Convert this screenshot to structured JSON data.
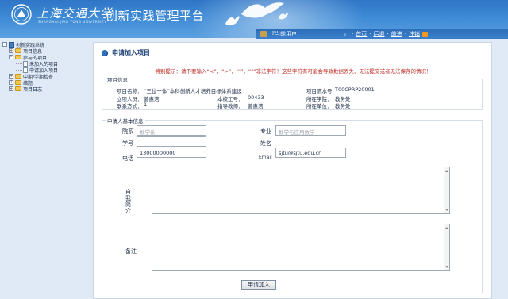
{
  "header": {
    "university_name": "上海交通大学",
    "university_name_en": "SHANGHAI JIAO TONG UNIVERSITY",
    "system_title": "创新实践管理平台",
    "current_user_label": "『当前用户：",
    "current_user_value": "",
    "current_user_close": "』",
    "links": [
      "首页",
      "后退",
      "前进",
      "注销"
    ],
    "brand_color": "#3e8ad6"
  },
  "sidebar": {
    "items": [
      {
        "label": "创新实践系统",
        "expander": "-",
        "icon": "system-icon",
        "level": 0
      },
      {
        "label": "项目信息",
        "expander": "+",
        "icon": "folder-icon",
        "level": 1
      },
      {
        "label": "参与的项目",
        "expander": "-",
        "icon": "folder-icon",
        "level": 1
      },
      {
        "label": "未加入的项目",
        "expander": "",
        "icon": "page-icon",
        "level": 2
      },
      {
        "label": "申请加入项目",
        "expander": "",
        "icon": "page-icon",
        "level": 2
      },
      {
        "label": "中期/学期检查",
        "expander": "+",
        "icon": "folder-icon",
        "level": 1
      },
      {
        "label": "结题",
        "expander": "+",
        "icon": "folder-icon",
        "level": 1
      },
      {
        "label": "项目日志",
        "expander": "+",
        "icon": "folder-icon",
        "level": 1
      }
    ]
  },
  "main": {
    "title": "申请加入项目",
    "warning": "特别提示：请不要输入“<”，“>”，“'”，“\"”非法字符！这些字符有可能会导致数据丢失、无法提交或者无法保存的情况！",
    "project_info": {
      "legend": "项目信息",
      "project_name_label": "项目名称：",
      "project_name": "“三位一体”本科创新人才培养目标体系建设",
      "serial_label": "项目流水号",
      "serial": "T00CPRP20001",
      "lead_label": "立项人员：",
      "lead": "姜惠洁",
      "staff_id_label": "本校工号：",
      "staff_id": "00433",
      "college_label": "所在学院：",
      "college": "教务处",
      "contact_label": "联系方式：",
      "contact": "1",
      "advisor_label": "指导教师：",
      "advisor": "姜惠洁",
      "unit_label": "所在单位：",
      "unit": "教务处"
    },
    "applicant": {
      "legend": "申请人基本信息",
      "dept_label": "院系",
      "dept_placeholder": "数学系",
      "major_label": "专业",
      "major_placeholder": "数学与应用数学",
      "student_id_label": "学号",
      "student_id_value": "",
      "name_label": "姓名",
      "name_value": "",
      "phone_label": "电话",
      "phone_value": "13000000000",
      "email_label": "Email",
      "email_value": "sjtu@sjtu.edu.cn",
      "intro_label": "自我简介",
      "remark_label": "备注"
    },
    "submit_label": "申请加入"
  }
}
